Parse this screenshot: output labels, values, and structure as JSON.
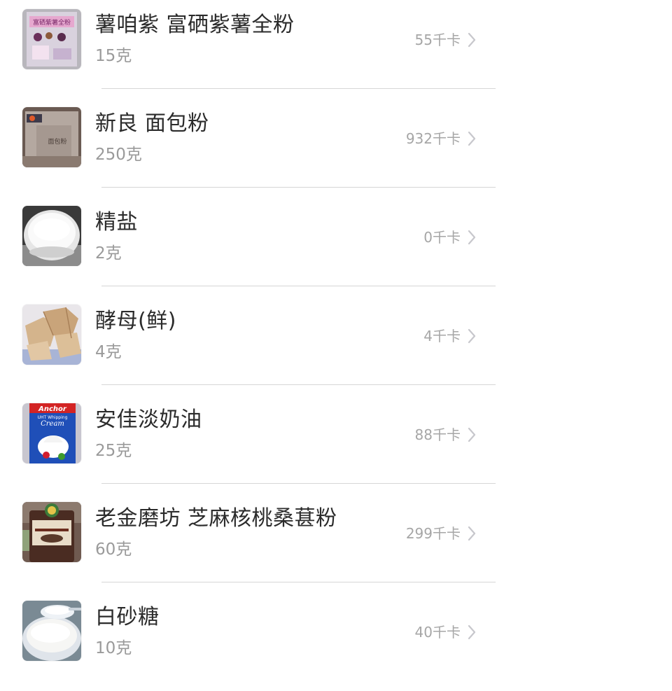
{
  "ingredients": [
    {
      "name": "薯咱紫 富硒紫薯全粉",
      "amount": "15克",
      "calories": "55千卡",
      "thumb_icon": "purple-sweet-potato-powder-package-photo",
      "thumb_text": "富硒紫薯全粉"
    },
    {
      "name": "新良 面包粉",
      "amount": "250克",
      "calories": "932千卡",
      "thumb_icon": "bread-flour-bag-photo",
      "thumb_text": "面包粉"
    },
    {
      "name": "精盐",
      "amount": "2克",
      "calories": "0千卡",
      "thumb_icon": "salt-bowl-photo"
    },
    {
      "name": "酵母(鲜)",
      "amount": "4克",
      "calories": "4千卡",
      "thumb_icon": "fresh-yeast-photo"
    },
    {
      "name": "安佳淡奶油",
      "amount": "25克",
      "calories": "88千卡",
      "thumb_icon": "whipping-cream-carton-photo",
      "thumb_text": "Anchor",
      "thumb_text2": "UHT Whipping",
      "thumb_text3": "Cream"
    },
    {
      "name": "老金磨坊 芝麻核桃桑葚粉",
      "amount": "60克",
      "calories": "299千卡",
      "thumb_icon": "sesame-walnut-mulberry-powder-jar-photo"
    },
    {
      "name": "白砂糖",
      "amount": "10克",
      "calories": "40千卡",
      "thumb_icon": "white-sugar-bowl-photo"
    }
  ],
  "chevron_icon": "chevron-right-icon",
  "colors": {
    "name_text": "#2b2b2b",
    "amount_text": "#9a9a9a",
    "calorie_text": "#a6a6a6",
    "divider": "#d6d6d6",
    "chevron": "#c7c7cc"
  }
}
